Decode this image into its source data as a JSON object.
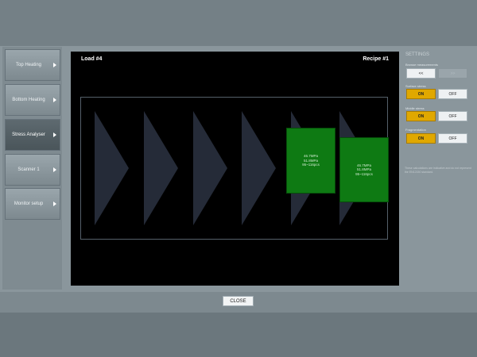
{
  "sidebar": {
    "items": [
      {
        "label": "Top Heating"
      },
      {
        "label": "Bottom Heating"
      },
      {
        "label": "Stress Analyser"
      },
      {
        "label": "Scanner 1"
      },
      {
        "label": "Monitor setup"
      }
    ],
    "active": "Stress Analyser"
  },
  "canvas": {
    "load_label": "Load #4",
    "recipe_label": "Recipe #1",
    "glass_panels": [
      {
        "line1": "46.7MPa",
        "line2": "51.8MPa",
        "line3": "95~116pcs"
      },
      {
        "line1": "46.7MPa",
        "line2": "51.8MPa",
        "line3": "95~116pcs"
      }
    ]
  },
  "settings": {
    "title": "SETTINGS",
    "browse": {
      "label": "Browse measurements",
      "prev": "<<",
      "next": ">>"
    },
    "surface": {
      "label": "Surface stress",
      "on": "ON",
      "off": "OFF",
      "state": "ON"
    },
    "middle": {
      "label": "Middle stress",
      "on": "ON",
      "off": "OFF",
      "state": "ON"
    },
    "fragmentation": {
      "label": "Fragmentation",
      "on": "ON",
      "off": "OFF",
      "state": "ON"
    },
    "info_text": "These calculations are indicative and do not represent the EN12150 standard."
  },
  "footer": {
    "close_label": "CLOSE"
  },
  "colors": {
    "active_toggle": "#e0a800",
    "glass_panel": "#0e7a13",
    "canvas_bg": "#000000"
  }
}
